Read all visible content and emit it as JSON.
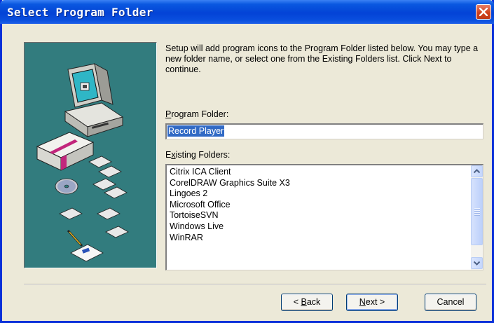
{
  "window": {
    "title": "Select Program Folder"
  },
  "content": {
    "instructions": "Setup will add program icons to the Program Folder listed below. You may type a new folder name, or select one from the Existing Folders list. Click Next to continue.",
    "program_folder_label_prefix": "",
    "program_folder_label_mnemonic": "P",
    "program_folder_label_rest": "rogram Folder:",
    "program_folder_value": "Record Player",
    "existing_folders_label_prefix": "E",
    "existing_folders_label_mnemonic": "x",
    "existing_folders_label_rest": "isting Folders:",
    "existing_folders": [
      "Citrix ICA Client",
      "CorelDRAW Graphics Suite X3",
      "Lingoes 2",
      "Microsoft Office",
      "TortoiseSVN",
      "Windows Live",
      "WinRAR"
    ]
  },
  "buttons": {
    "back_lt": "< ",
    "back_mnemonic": "B",
    "back_rest": "ack",
    "next_mnemonic": "N",
    "next_rest": "ext >",
    "cancel": "Cancel"
  },
  "icons": {
    "close": "close-x-icon",
    "illustration": "computer-setup-illustration",
    "scroll_up": "scroll-up-arrow-icon",
    "scroll_down": "scroll-down-arrow-icon"
  },
  "colors": {
    "titlebar": "#0343d6",
    "side_panel": "#327c7e",
    "selection": "#316ac5",
    "dialog_bg": "#ece9d8"
  }
}
